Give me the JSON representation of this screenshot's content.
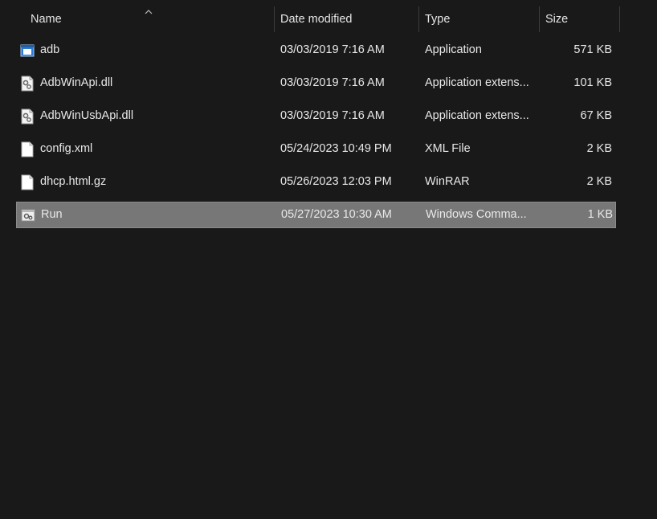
{
  "columns": {
    "name": "Name",
    "date": "Date modified",
    "type": "Type",
    "size": "Size"
  },
  "sort": {
    "column": "name",
    "direction": "ascending",
    "icon": "chevron-up-icon"
  },
  "files": [
    {
      "name": "adb",
      "date": "03/03/2019 7:16 AM",
      "type": "Application",
      "size": "571 KB",
      "icon": "application-exe-icon",
      "selected": false
    },
    {
      "name": "AdbWinApi.dll",
      "date": "03/03/2019 7:16 AM",
      "type": "Application extens...",
      "size": "101 KB",
      "icon": "dll-gear-file-icon",
      "selected": false
    },
    {
      "name": "AdbWinUsbApi.dll",
      "date": "03/03/2019 7:16 AM",
      "type": "Application extens...",
      "size": "67 KB",
      "icon": "dll-gear-file-icon",
      "selected": false
    },
    {
      "name": "config.xml",
      "date": "05/24/2023 10:49 PM",
      "type": "XML File",
      "size": "2 KB",
      "icon": "blank-file-icon",
      "selected": false
    },
    {
      "name": "dhcp.html.gz",
      "date": "05/26/2023 12:03 PM",
      "type": "WinRAR",
      "size": "2 KB",
      "icon": "blank-file-icon",
      "selected": false
    },
    {
      "name": "Run",
      "date": "05/27/2023 10:30 AM",
      "type": "Windows Comma...",
      "size": "1 KB",
      "icon": "batch-script-icon",
      "selected": true
    }
  ],
  "colors": {
    "background": "#191919",
    "selection": "#777777",
    "text": "#e8e8e8"
  }
}
